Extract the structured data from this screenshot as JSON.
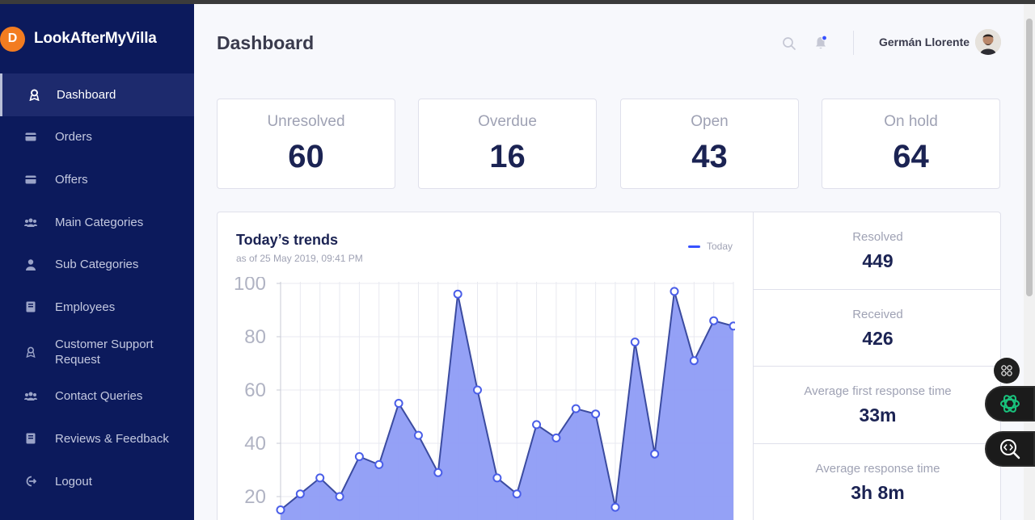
{
  "brand": {
    "name": "LookAfterMyVilla",
    "logo_letter": "D",
    "accent": "#f37c20"
  },
  "sidebar": {
    "items": [
      {
        "label": "Dashboard",
        "icon": "award-icon",
        "active": true
      },
      {
        "label": "Orders",
        "icon": "card-icon"
      },
      {
        "label": "Offers",
        "icon": "card-icon"
      },
      {
        "label": "Main Categories",
        "icon": "users-icon"
      },
      {
        "label": "Sub Categories",
        "icon": "user-icon"
      },
      {
        "label": "Employees",
        "icon": "book-icon"
      },
      {
        "label": "Customer Support Request",
        "icon": "award-icon"
      },
      {
        "label": "Contact Queries",
        "icon": "users-icon"
      },
      {
        "label": "Reviews & Feedback",
        "icon": "book-icon"
      },
      {
        "label": "Logout",
        "icon": "logout-icon"
      }
    ]
  },
  "header": {
    "title": "Dashboard",
    "user_name": "Germán Llorente"
  },
  "stats": [
    {
      "label": "Unresolved",
      "value": "60"
    },
    {
      "label": "Overdue",
      "value": "16"
    },
    {
      "label": "Open",
      "value": "43"
    },
    {
      "label": "On hold",
      "value": "64"
    }
  ],
  "trends": {
    "title": "Today’s trends",
    "subtitle": "as of 25 May 2019, 09:41 PM",
    "legend": "Today"
  },
  "side_stats": [
    {
      "label": "Resolved",
      "value": "449"
    },
    {
      "label": "Received",
      "value": "426"
    },
    {
      "label": "Average first response time",
      "value": "33m"
    },
    {
      "label": "Average response time",
      "value": "3h 8m"
    }
  ],
  "chart_data": {
    "type": "area",
    "series": [
      {
        "name": "Today",
        "values": [
          15,
          21,
          27,
          20,
          35,
          32,
          55,
          43,
          29,
          96,
          60,
          27,
          21,
          47,
          42,
          53,
          51,
          16,
          78,
          36,
          97,
          71,
          86,
          84
        ]
      }
    ],
    "y_ticks": [
      "20",
      "40",
      "60",
      "80",
      "100"
    ],
    "ylim": [
      10,
      100
    ],
    "grid": true,
    "color": "#8e9cf5",
    "line_color": "#3b4ba0"
  }
}
